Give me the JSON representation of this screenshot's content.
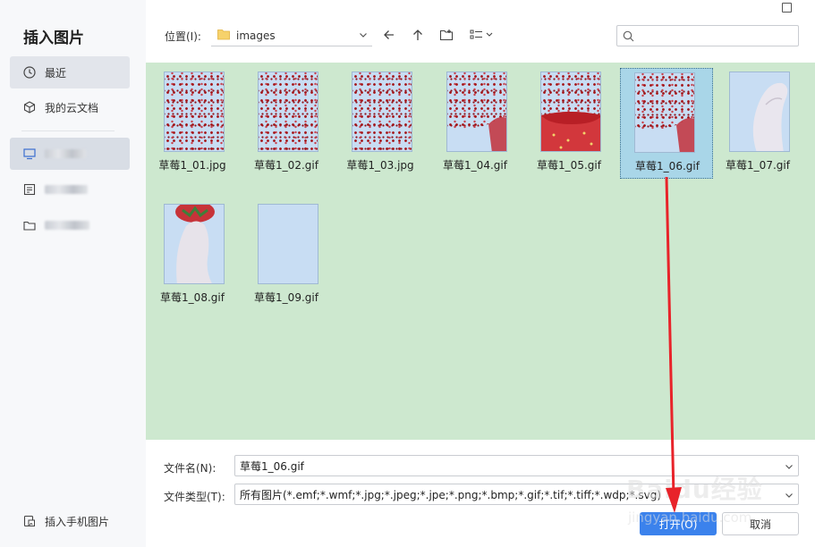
{
  "dialog": {
    "title": "插入图片"
  },
  "sidebar": {
    "items": [
      {
        "label": "最近",
        "icon": "clock-icon"
      },
      {
        "label": "我的云文档",
        "icon": "cloud-cube-icon"
      },
      {
        "label": "",
        "icon": "monitor-icon"
      },
      {
        "label": "",
        "icon": "document-icon"
      },
      {
        "label": "",
        "icon": "folder-icon"
      }
    ],
    "phone_label": "插入手机图片"
  },
  "toolbar": {
    "location_label": "位置(I):",
    "path": "images",
    "back_icon": "arrow-left-icon",
    "up_icon": "arrow-up-icon",
    "new_folder_icon": "new-folder-icon",
    "view_icon": "view-list-icon",
    "search_placeholder": ""
  },
  "files": [
    {
      "name": "草莓1_01.jpg",
      "thumb": "dots"
    },
    {
      "name": "草莓1_02.gif",
      "thumb": "dots"
    },
    {
      "name": "草莓1_03.jpg",
      "thumb": "dots"
    },
    {
      "name": "草莓1_04.gif",
      "thumb": "dots-hand"
    },
    {
      "name": "草莓1_05.gif",
      "thumb": "strawberry"
    },
    {
      "name": "草莓1_06.gif",
      "thumb": "dots-hand",
      "selected": true
    },
    {
      "name": "草莓1_07.gif",
      "thumb": "hand"
    },
    {
      "name": "草莓1_08.gif",
      "thumb": "hand-strawberry"
    },
    {
      "name": "草莓1_09.gif",
      "thumb": "blank"
    }
  ],
  "form": {
    "filename_label": "文件名(N):",
    "filename_value": "草莓1_06.gif",
    "filetype_label": "文件类型(T):",
    "filetype_value": "所有图片(*.emf;*.wmf;*.jpg;*.jpeg;*.jpe;*.png;*.bmp;*.gif;*.tif;*.tiff;*.wdp;*.svg)"
  },
  "buttons": {
    "open": "打开(O)",
    "cancel": "取消"
  },
  "watermark": {
    "brand": "Baidu经验",
    "url": "jingyan.baidu.com"
  },
  "colors": {
    "accent": "#3b82ec",
    "file_area_bg": "#cde8cf",
    "selection_bg": "#a9d6e8",
    "annotation_arrow": "#e8232a"
  }
}
